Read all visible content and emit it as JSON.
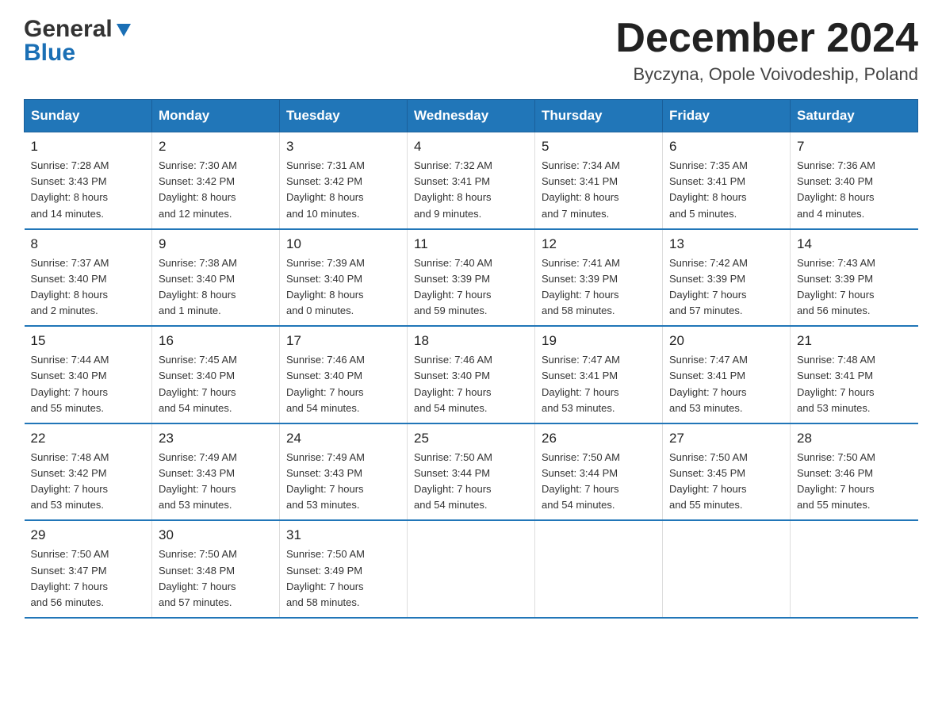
{
  "logo": {
    "line1": "General",
    "line2": "Blue"
  },
  "header": {
    "month": "December 2024",
    "location": "Byczyna, Opole Voivodeship, Poland"
  },
  "days_of_week": [
    "Sunday",
    "Monday",
    "Tuesday",
    "Wednesday",
    "Thursday",
    "Friday",
    "Saturday"
  ],
  "weeks": [
    [
      {
        "day": "1",
        "sunrise": "7:28 AM",
        "sunset": "3:43 PM",
        "daylight": "8 hours and 14 minutes."
      },
      {
        "day": "2",
        "sunrise": "7:30 AM",
        "sunset": "3:42 PM",
        "daylight": "8 hours and 12 minutes."
      },
      {
        "day": "3",
        "sunrise": "7:31 AM",
        "sunset": "3:42 PM",
        "daylight": "8 hours and 10 minutes."
      },
      {
        "day": "4",
        "sunrise": "7:32 AM",
        "sunset": "3:41 PM",
        "daylight": "8 hours and 9 minutes."
      },
      {
        "day": "5",
        "sunrise": "7:34 AM",
        "sunset": "3:41 PM",
        "daylight": "8 hours and 7 minutes."
      },
      {
        "day": "6",
        "sunrise": "7:35 AM",
        "sunset": "3:41 PM",
        "daylight": "8 hours and 5 minutes."
      },
      {
        "day": "7",
        "sunrise": "7:36 AM",
        "sunset": "3:40 PM",
        "daylight": "8 hours and 4 minutes."
      }
    ],
    [
      {
        "day": "8",
        "sunrise": "7:37 AM",
        "sunset": "3:40 PM",
        "daylight": "8 hours and 2 minutes."
      },
      {
        "day": "9",
        "sunrise": "7:38 AM",
        "sunset": "3:40 PM",
        "daylight": "8 hours and 1 minute."
      },
      {
        "day": "10",
        "sunrise": "7:39 AM",
        "sunset": "3:40 PM",
        "daylight": "8 hours and 0 minutes."
      },
      {
        "day": "11",
        "sunrise": "7:40 AM",
        "sunset": "3:39 PM",
        "daylight": "7 hours and 59 minutes."
      },
      {
        "day": "12",
        "sunrise": "7:41 AM",
        "sunset": "3:39 PM",
        "daylight": "7 hours and 58 minutes."
      },
      {
        "day": "13",
        "sunrise": "7:42 AM",
        "sunset": "3:39 PM",
        "daylight": "7 hours and 57 minutes."
      },
      {
        "day": "14",
        "sunrise": "7:43 AM",
        "sunset": "3:39 PM",
        "daylight": "7 hours and 56 minutes."
      }
    ],
    [
      {
        "day": "15",
        "sunrise": "7:44 AM",
        "sunset": "3:40 PM",
        "daylight": "7 hours and 55 minutes."
      },
      {
        "day": "16",
        "sunrise": "7:45 AM",
        "sunset": "3:40 PM",
        "daylight": "7 hours and 54 minutes."
      },
      {
        "day": "17",
        "sunrise": "7:46 AM",
        "sunset": "3:40 PM",
        "daylight": "7 hours and 54 minutes."
      },
      {
        "day": "18",
        "sunrise": "7:46 AM",
        "sunset": "3:40 PM",
        "daylight": "7 hours and 54 minutes."
      },
      {
        "day": "19",
        "sunrise": "7:47 AM",
        "sunset": "3:41 PM",
        "daylight": "7 hours and 53 minutes."
      },
      {
        "day": "20",
        "sunrise": "7:47 AM",
        "sunset": "3:41 PM",
        "daylight": "7 hours and 53 minutes."
      },
      {
        "day": "21",
        "sunrise": "7:48 AM",
        "sunset": "3:41 PM",
        "daylight": "7 hours and 53 minutes."
      }
    ],
    [
      {
        "day": "22",
        "sunrise": "7:48 AM",
        "sunset": "3:42 PM",
        "daylight": "7 hours and 53 minutes."
      },
      {
        "day": "23",
        "sunrise": "7:49 AM",
        "sunset": "3:43 PM",
        "daylight": "7 hours and 53 minutes."
      },
      {
        "day": "24",
        "sunrise": "7:49 AM",
        "sunset": "3:43 PM",
        "daylight": "7 hours and 53 minutes."
      },
      {
        "day": "25",
        "sunrise": "7:50 AM",
        "sunset": "3:44 PM",
        "daylight": "7 hours and 54 minutes."
      },
      {
        "day": "26",
        "sunrise": "7:50 AM",
        "sunset": "3:44 PM",
        "daylight": "7 hours and 54 minutes."
      },
      {
        "day": "27",
        "sunrise": "7:50 AM",
        "sunset": "3:45 PM",
        "daylight": "7 hours and 55 minutes."
      },
      {
        "day": "28",
        "sunrise": "7:50 AM",
        "sunset": "3:46 PM",
        "daylight": "7 hours and 55 minutes."
      }
    ],
    [
      {
        "day": "29",
        "sunrise": "7:50 AM",
        "sunset": "3:47 PM",
        "daylight": "7 hours and 56 minutes."
      },
      {
        "day": "30",
        "sunrise": "7:50 AM",
        "sunset": "3:48 PM",
        "daylight": "7 hours and 57 minutes."
      },
      {
        "day": "31",
        "sunrise": "7:50 AM",
        "sunset": "3:49 PM",
        "daylight": "7 hours and 58 minutes."
      },
      null,
      null,
      null,
      null
    ]
  ],
  "labels": {
    "sunrise": "Sunrise:",
    "sunset": "Sunset:",
    "daylight": "Daylight:"
  }
}
